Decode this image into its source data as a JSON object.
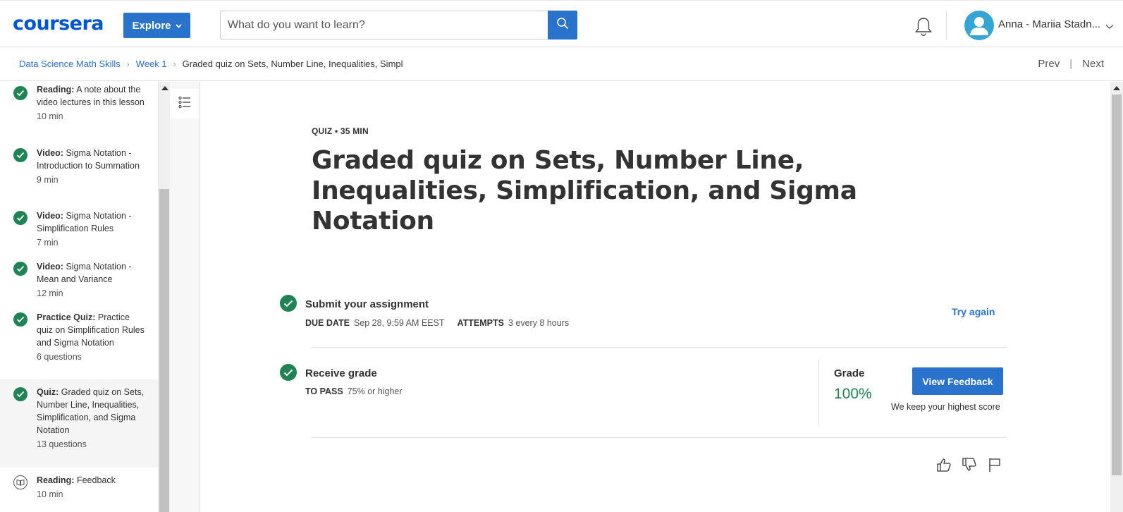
{
  "header": {
    "logo_text": "coursera",
    "explore_label": "Explore",
    "search_placeholder": "What do you want to learn?",
    "user_name": "Anna - Mariia Stadn...",
    "brand_color": "#0056d2",
    "accent_color": "#2a73cc"
  },
  "breadcrumb": {
    "items": [
      "Data Science Math Skills",
      "Week 1",
      "Graded quiz on Sets, Number Line, Inequalities, Simpl"
    ],
    "prev": "Prev",
    "next": "Next"
  },
  "sidebar": {
    "items": [
      {
        "type": "Reading:",
        "title": "A note about the video lectures in this lesson",
        "meta": "10 min",
        "status": "completed"
      },
      {
        "type": "Video:",
        "title": "Sigma Notation - Introduction to Summation",
        "meta": "9 min",
        "status": "completed"
      },
      {
        "type": "Video:",
        "title": "Sigma Notation - Simplification Rules",
        "meta": "7 min",
        "status": "completed"
      },
      {
        "type": "Video:",
        "title": "Sigma Notation - Mean and Variance",
        "meta": "12 min",
        "status": "completed"
      },
      {
        "type": "Practice Quiz:",
        "title": "Practice quiz on Simplification Rules and Sigma Notation",
        "meta": "6 questions",
        "status": "completed"
      },
      {
        "type": "Quiz:",
        "title": "Graded quiz on Sets, Number Line, Inequalities, Simplification, and Sigma Notation",
        "meta": "13 questions",
        "status": "completed"
      },
      {
        "type": "Reading:",
        "title": "Feedback",
        "meta": "10 min",
        "status": "not-started"
      }
    ]
  },
  "main": {
    "quiz_meta": "QUIZ • 35 MIN",
    "title": "Graded quiz on Sets, Number Line, Inequalities, Simplification, and Sigma Notation",
    "submit": {
      "title": "Submit your assignment",
      "due_label": "DUE DATE",
      "due_value": "Sep 28, 9:59 AM EEST",
      "attempts_label": "ATTEMPTS",
      "attempts_value": "3 every 8 hours",
      "try_again": "Try again"
    },
    "receive": {
      "title": "Receive grade",
      "pass_label": "TO PASS",
      "pass_value": "75% or higher"
    },
    "grade": {
      "label": "Grade",
      "value": "100%",
      "button": "View Feedback",
      "note": "We keep your highest score",
      "color": "#1f8354"
    }
  }
}
